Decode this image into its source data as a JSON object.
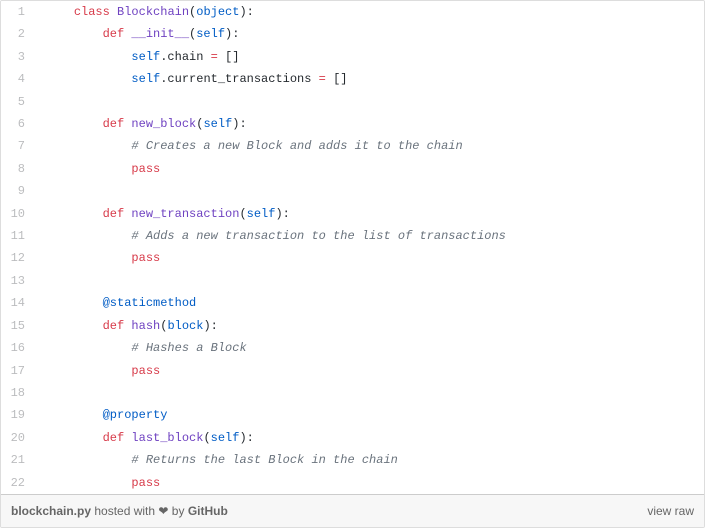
{
  "filename": "blockchain.py",
  "hosted_text": " hosted with ",
  "heart": "❤",
  "by_text": " by ",
  "github_text": "GitHub",
  "view_raw": "view raw",
  "lines": [
    {
      "n": 1,
      "tokens": [
        {
          "t": "    ",
          "c": "plain"
        },
        {
          "t": "class",
          "c": "kw"
        },
        {
          "t": " ",
          "c": "plain"
        },
        {
          "t": "Blockchain",
          "c": "cls"
        },
        {
          "t": "(",
          "c": "plain"
        },
        {
          "t": "object",
          "c": "builtin"
        },
        {
          "t": "):",
          "c": "plain"
        }
      ]
    },
    {
      "n": 2,
      "tokens": [
        {
          "t": "        ",
          "c": "plain"
        },
        {
          "t": "def",
          "c": "kw"
        },
        {
          "t": " ",
          "c": "plain"
        },
        {
          "t": "__init__",
          "c": "func"
        },
        {
          "t": "(",
          "c": "plain"
        },
        {
          "t": "self",
          "c": "builtin"
        },
        {
          "t": "):",
          "c": "plain"
        }
      ]
    },
    {
      "n": 3,
      "tokens": [
        {
          "t": "            ",
          "c": "plain"
        },
        {
          "t": "self",
          "c": "builtin"
        },
        {
          "t": ".chain ",
          "c": "plain"
        },
        {
          "t": "=",
          "c": "kw"
        },
        {
          "t": " []",
          "c": "plain"
        }
      ]
    },
    {
      "n": 4,
      "tokens": [
        {
          "t": "            ",
          "c": "plain"
        },
        {
          "t": "self",
          "c": "builtin"
        },
        {
          "t": ".current_transactions ",
          "c": "plain"
        },
        {
          "t": "=",
          "c": "kw"
        },
        {
          "t": " []",
          "c": "plain"
        }
      ]
    },
    {
      "n": 5,
      "tokens": [
        {
          "t": "",
          "c": "plain"
        }
      ]
    },
    {
      "n": 6,
      "tokens": [
        {
          "t": "        ",
          "c": "plain"
        },
        {
          "t": "def",
          "c": "kw"
        },
        {
          "t": " ",
          "c": "plain"
        },
        {
          "t": "new_block",
          "c": "func"
        },
        {
          "t": "(",
          "c": "plain"
        },
        {
          "t": "self",
          "c": "builtin"
        },
        {
          "t": "):",
          "c": "plain"
        }
      ]
    },
    {
      "n": 7,
      "tokens": [
        {
          "t": "            ",
          "c": "plain"
        },
        {
          "t": "# Creates a new Block and adds it to the chain",
          "c": "comment"
        }
      ]
    },
    {
      "n": 8,
      "tokens": [
        {
          "t": "            ",
          "c": "plain"
        },
        {
          "t": "pass",
          "c": "kw"
        }
      ]
    },
    {
      "n": 9,
      "tokens": [
        {
          "t": "",
          "c": "plain"
        }
      ]
    },
    {
      "n": 10,
      "tokens": [
        {
          "t": "        ",
          "c": "plain"
        },
        {
          "t": "def",
          "c": "kw"
        },
        {
          "t": " ",
          "c": "plain"
        },
        {
          "t": "new_transaction",
          "c": "func"
        },
        {
          "t": "(",
          "c": "plain"
        },
        {
          "t": "self",
          "c": "builtin"
        },
        {
          "t": "):",
          "c": "plain"
        }
      ]
    },
    {
      "n": 11,
      "tokens": [
        {
          "t": "            ",
          "c": "plain"
        },
        {
          "t": "# Adds a new transaction to the list of transactions",
          "c": "comment"
        }
      ]
    },
    {
      "n": 12,
      "tokens": [
        {
          "t": "            ",
          "c": "plain"
        },
        {
          "t": "pass",
          "c": "kw"
        }
      ]
    },
    {
      "n": 13,
      "tokens": [
        {
          "t": "",
          "c": "plain"
        }
      ]
    },
    {
      "n": 14,
      "tokens": [
        {
          "t": "        ",
          "c": "plain"
        },
        {
          "t": "@staticmethod",
          "c": "decor"
        }
      ]
    },
    {
      "n": 15,
      "tokens": [
        {
          "t": "        ",
          "c": "plain"
        },
        {
          "t": "def",
          "c": "kw"
        },
        {
          "t": " ",
          "c": "plain"
        },
        {
          "t": "hash",
          "c": "func"
        },
        {
          "t": "(",
          "c": "plain"
        },
        {
          "t": "block",
          "c": "builtin"
        },
        {
          "t": "):",
          "c": "plain"
        }
      ]
    },
    {
      "n": 16,
      "tokens": [
        {
          "t": "            ",
          "c": "plain"
        },
        {
          "t": "# Hashes a Block",
          "c": "comment"
        }
      ]
    },
    {
      "n": 17,
      "tokens": [
        {
          "t": "            ",
          "c": "plain"
        },
        {
          "t": "pass",
          "c": "kw"
        }
      ]
    },
    {
      "n": 18,
      "tokens": [
        {
          "t": "",
          "c": "plain"
        }
      ]
    },
    {
      "n": 19,
      "tokens": [
        {
          "t": "        ",
          "c": "plain"
        },
        {
          "t": "@property",
          "c": "decor"
        }
      ]
    },
    {
      "n": 20,
      "tokens": [
        {
          "t": "        ",
          "c": "plain"
        },
        {
          "t": "def",
          "c": "kw"
        },
        {
          "t": " ",
          "c": "plain"
        },
        {
          "t": "last_block",
          "c": "func"
        },
        {
          "t": "(",
          "c": "plain"
        },
        {
          "t": "self",
          "c": "builtin"
        },
        {
          "t": "):",
          "c": "plain"
        }
      ]
    },
    {
      "n": 21,
      "tokens": [
        {
          "t": "            ",
          "c": "plain"
        },
        {
          "t": "# Returns the last Block in the chain",
          "c": "comment"
        }
      ]
    },
    {
      "n": 22,
      "tokens": [
        {
          "t": "            ",
          "c": "plain"
        },
        {
          "t": "pass",
          "c": "kw"
        }
      ]
    }
  ]
}
